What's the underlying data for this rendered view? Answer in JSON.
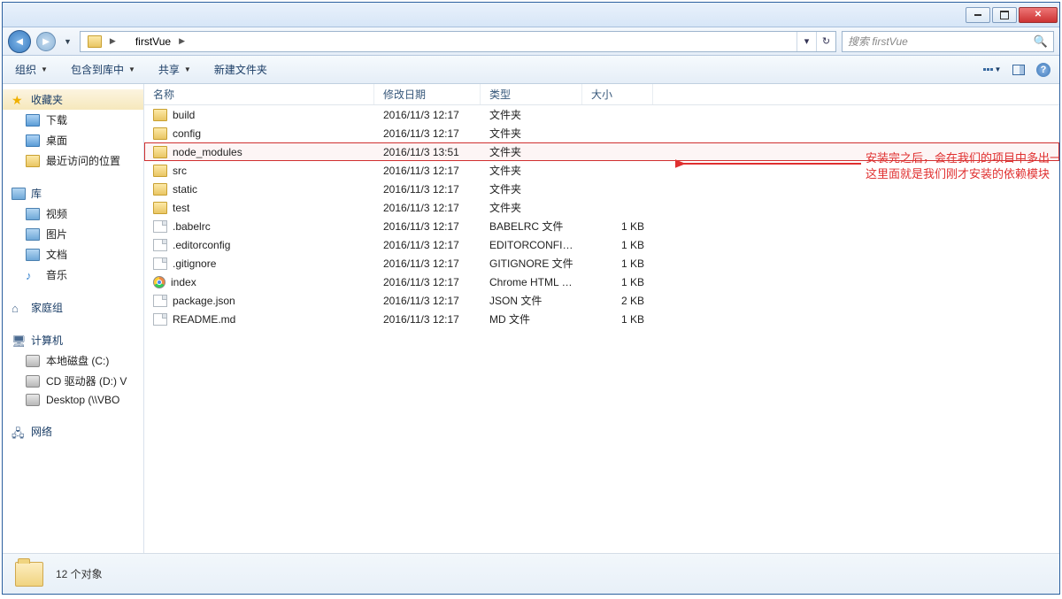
{
  "title": "firstVue",
  "breadcrumb": {
    "folder": "firstVue"
  },
  "search": {
    "placeholder": "搜索 firstVue"
  },
  "toolbar": {
    "organize": "组织",
    "include": "包含到库中",
    "share": "共享",
    "newfolder": "新建文件夹"
  },
  "columns": {
    "name": "名称",
    "date": "修改日期",
    "type": "类型",
    "size": "大小"
  },
  "sidebar": {
    "favorites": "收藏夹",
    "fav_items": [
      "下载",
      "桌面",
      "最近访问的位置"
    ],
    "libraries": "库",
    "lib_items": [
      "视频",
      "图片",
      "文档",
      "音乐"
    ],
    "homegroup": "家庭组",
    "computer": "计算机",
    "drives": [
      "本地磁盘 (C:)",
      "CD 驱动器 (D:) V",
      "Desktop (\\\\VBO"
    ],
    "network": "网络"
  },
  "files": [
    {
      "name": "build",
      "date": "2016/11/3 12:17",
      "type": "文件夹",
      "size": "",
      "icon": "folder",
      "hl": false
    },
    {
      "name": "config",
      "date": "2016/11/3 12:17",
      "type": "文件夹",
      "size": "",
      "icon": "folder",
      "hl": false
    },
    {
      "name": "node_modules",
      "date": "2016/11/3 13:51",
      "type": "文件夹",
      "size": "",
      "icon": "folder",
      "hl": true
    },
    {
      "name": "src",
      "date": "2016/11/3 12:17",
      "type": "文件夹",
      "size": "",
      "icon": "folder",
      "hl": false
    },
    {
      "name": "static",
      "date": "2016/11/3 12:17",
      "type": "文件夹",
      "size": "",
      "icon": "folder",
      "hl": false
    },
    {
      "name": "test",
      "date": "2016/11/3 12:17",
      "type": "文件夹",
      "size": "",
      "icon": "folder",
      "hl": false
    },
    {
      "name": ".babelrc",
      "date": "2016/11/3 12:17",
      "type": "BABELRC 文件",
      "size": "1 KB",
      "icon": "file",
      "hl": false
    },
    {
      "name": ".editorconfig",
      "date": "2016/11/3 12:17",
      "type": "EDITORCONFIG ...",
      "size": "1 KB",
      "icon": "file",
      "hl": false
    },
    {
      "name": ".gitignore",
      "date": "2016/11/3 12:17",
      "type": "GITIGNORE 文件",
      "size": "1 KB",
      "icon": "file",
      "hl": false
    },
    {
      "name": "index",
      "date": "2016/11/3 12:17",
      "type": "Chrome HTML D...",
      "size": "1 KB",
      "icon": "chrome",
      "hl": false
    },
    {
      "name": "package.json",
      "date": "2016/11/3 12:17",
      "type": "JSON 文件",
      "size": "2 KB",
      "icon": "file",
      "hl": false
    },
    {
      "name": "README.md",
      "date": "2016/11/3 12:17",
      "type": "MD 文件",
      "size": "1 KB",
      "icon": "file",
      "hl": false
    }
  ],
  "annotation": {
    "line1": "安装完之后，会在我们的项目中多出一个文件夹，",
    "line2": "这里面就是我们刚才安装的依赖模块"
  },
  "status": "12 个对象"
}
